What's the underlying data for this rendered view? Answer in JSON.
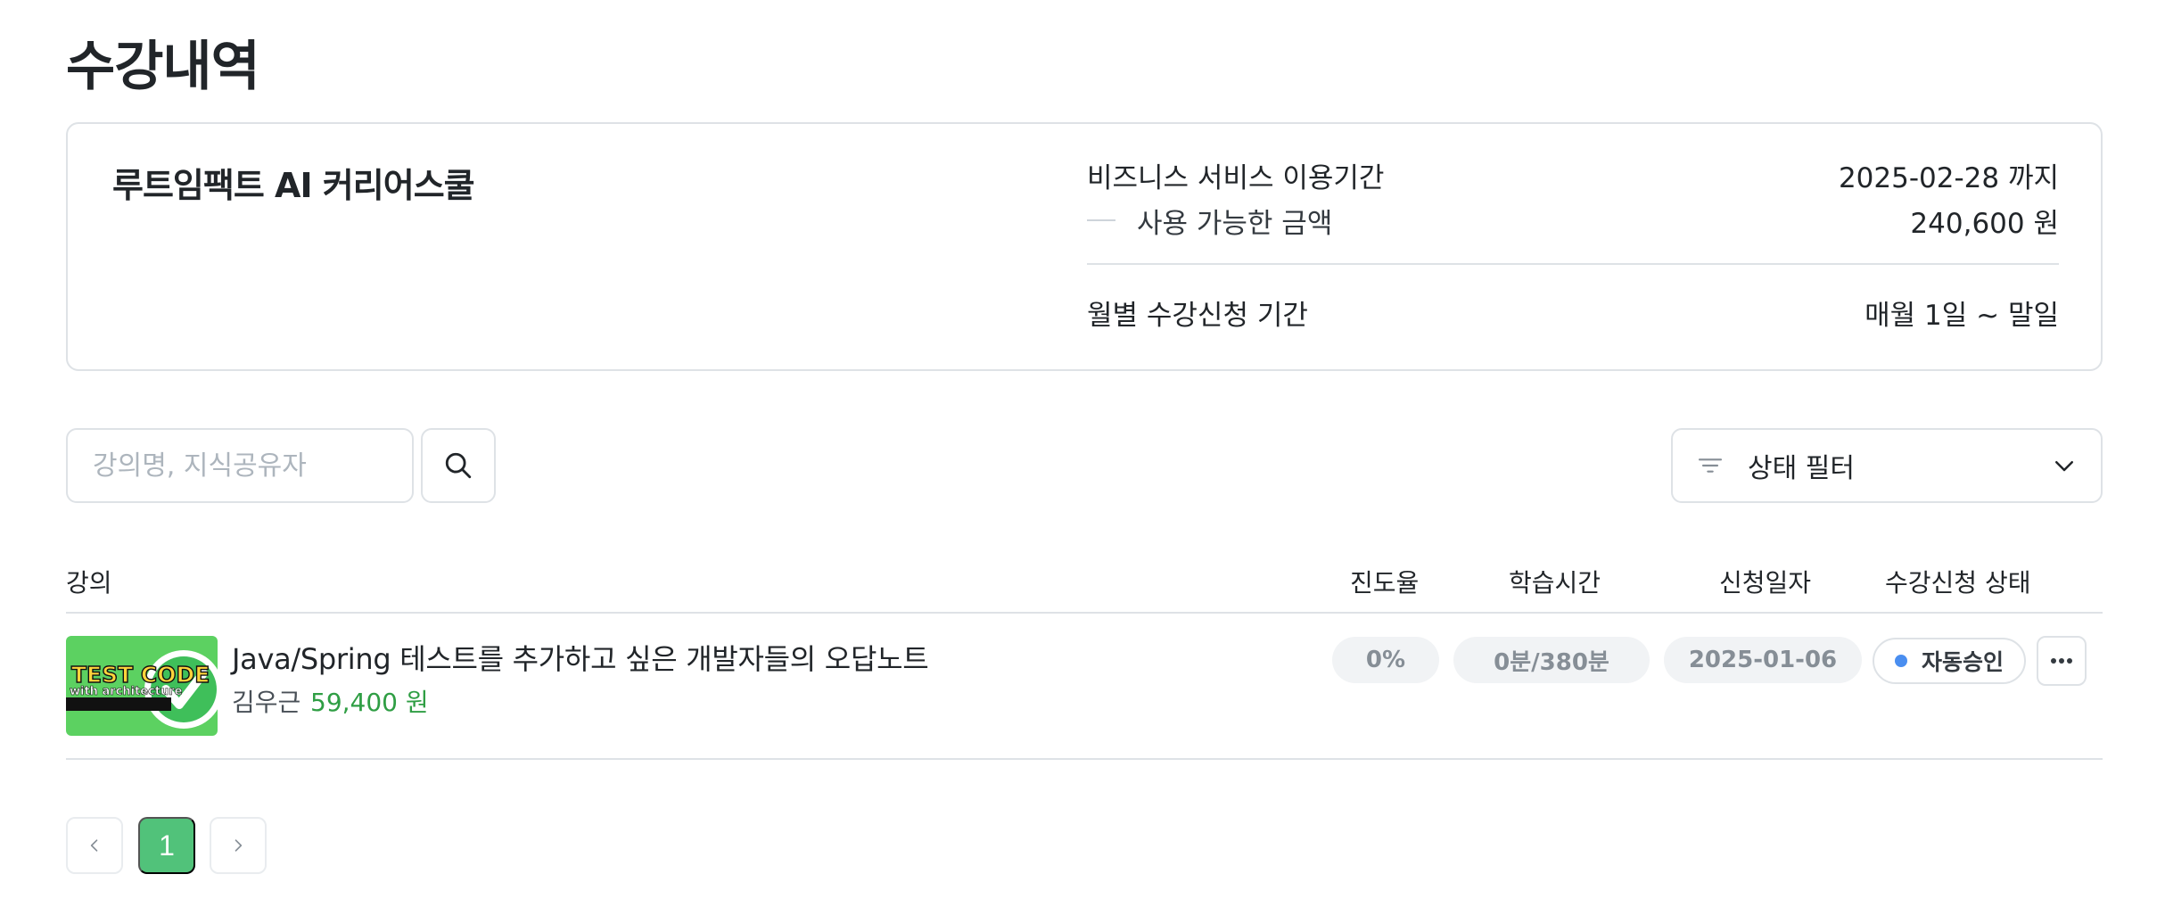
{
  "page": {
    "title": "수강내역"
  },
  "summary": {
    "org_name": "루트임팩트 AI 커리어스쿨",
    "rows": [
      {
        "label": "비즈니스 서비스 이용기간",
        "value": "2025-02-28 까지"
      },
      {
        "label": "사용 가능한 금액",
        "value": "240,600 원"
      },
      {
        "label": "월별 수강신청 기간",
        "value": "매월 1일 ~ 말일"
      }
    ]
  },
  "search": {
    "placeholder": "강의명, 지식공유자",
    "value": ""
  },
  "filter": {
    "label": "상태 필터"
  },
  "table": {
    "headers": {
      "course": "강의",
      "progress": "진도율",
      "study_time": "학습시간",
      "applied_date": "신청일자",
      "status": "수강신청 상태"
    },
    "rows": [
      {
        "thumbnail": {
          "line1": "TEST CODE",
          "line2": "with architecture"
        },
        "title": "Java/Spring 테스트를 추가하고 싶은 개발자들의 오답노트",
        "instructor": "김우근",
        "price": "59,400 원",
        "progress": "0%",
        "study_time": "0분/380분",
        "applied_date": "2025-01-06",
        "status": "자동승인",
        "status_color": "#4a8ef0"
      }
    ]
  },
  "pagination": {
    "current": "1"
  },
  "colors": {
    "accent": "#51c27a",
    "price": "#2f9e44",
    "border": "#dee2e6"
  }
}
